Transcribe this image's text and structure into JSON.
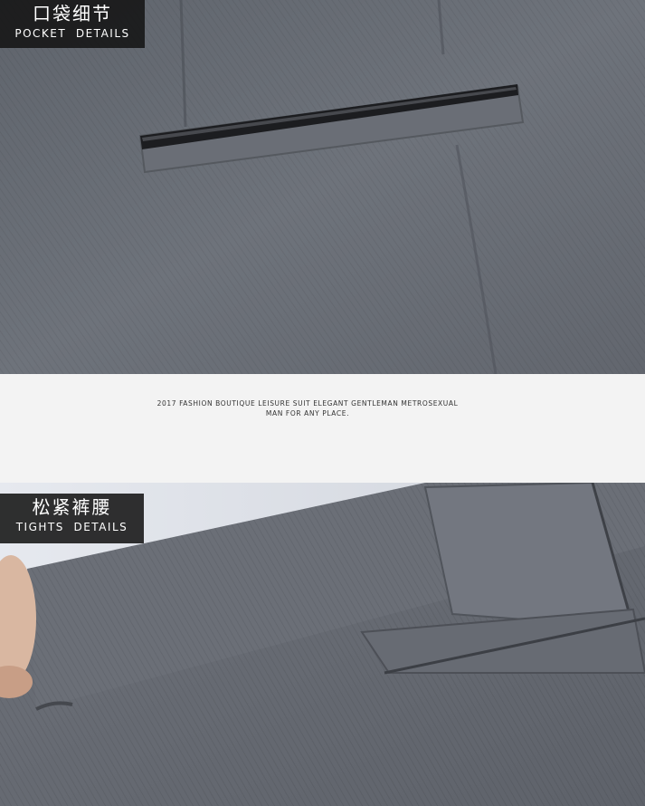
{
  "pocket_section": {
    "label_zh": "口袋细节",
    "label_en": "POCKET  DETAILS"
  },
  "tagline": {
    "line1": "2017 FASHION BOUTIQUE LEISURE SUIT ELEGANT  GENTLEMAN METROSEXUAL",
    "line2": "MAN FOR ANY PLACE."
  },
  "tights_section": {
    "label_zh": "松紧裤腰",
    "label_en": "TIGHTS  DETAILS"
  },
  "colors": {
    "fabric": "#6b6f76",
    "fabric_dark": "#4e525a",
    "label_bg": "#141414",
    "band_bg": "#f3f3f3"
  }
}
